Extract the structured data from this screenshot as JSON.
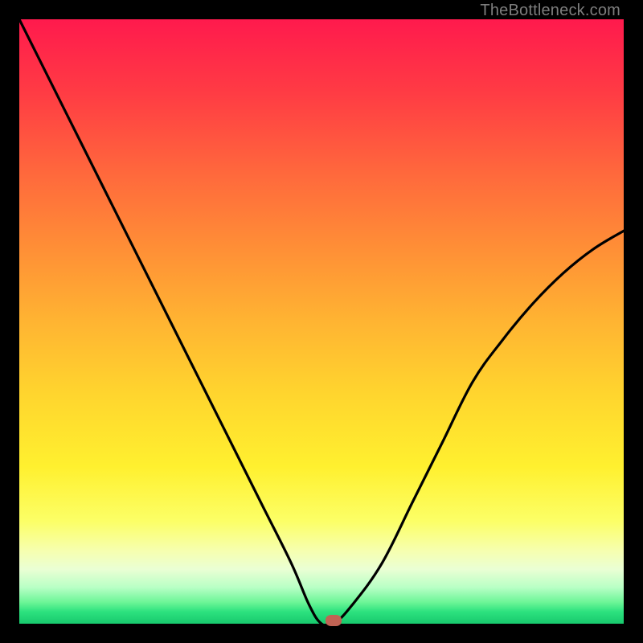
{
  "watermark": "TheBottleneck.com",
  "gradient_colors": {
    "top": "#ff1a4d",
    "mid": "#ffd52e",
    "bottom": "#18c96d"
  },
  "chart_data": {
    "type": "line",
    "title": "",
    "xlabel": "",
    "ylabel": "",
    "series": [
      {
        "name": "bottleneck-curve",
        "x": [
          0.0,
          0.05,
          0.1,
          0.15,
          0.2,
          0.25,
          0.3,
          0.35,
          0.4,
          0.45,
          0.48,
          0.5,
          0.52,
          0.55,
          0.6,
          0.65,
          0.7,
          0.75,
          0.8,
          0.85,
          0.9,
          0.95,
          1.0
        ],
        "y": [
          1.0,
          0.9,
          0.8,
          0.7,
          0.6,
          0.5,
          0.4,
          0.3,
          0.2,
          0.1,
          0.03,
          0.0,
          0.0,
          0.03,
          0.1,
          0.2,
          0.3,
          0.4,
          0.47,
          0.53,
          0.58,
          0.62,
          0.65
        ]
      }
    ],
    "xlim": [
      0,
      1
    ],
    "ylim": [
      0,
      1
    ],
    "marker": {
      "x": 0.52,
      "y": 0.0
    }
  }
}
